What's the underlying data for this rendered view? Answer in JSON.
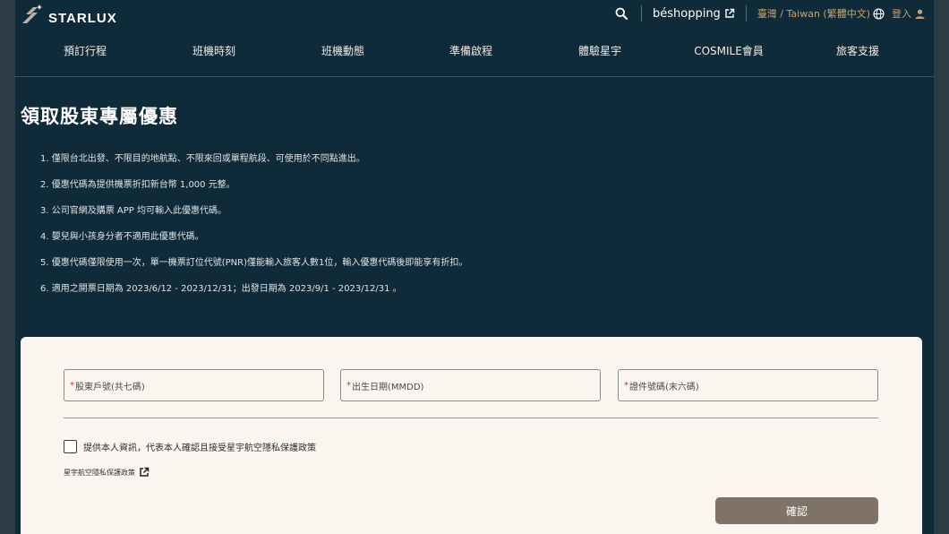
{
  "header": {
    "brand": "STARLUX",
    "beshopping": "béshopping",
    "region": "臺灣 / Taiwan (繁體中文)",
    "login": "登入"
  },
  "nav": {
    "items": [
      {
        "label": "預訂行程"
      },
      {
        "label": "班機時刻"
      },
      {
        "label": "班機動態"
      },
      {
        "label": "準備啟程"
      },
      {
        "label": "體驗星宇"
      },
      {
        "label": "COSMILE會員"
      },
      {
        "label": "旅客支援"
      }
    ]
  },
  "main": {
    "title": "領取股東專屬優惠",
    "terms": [
      "1. 僅限台北出發、不限目的地航點、不限來回或單程航段、可使用於不同點進出。",
      "2. 優惠代碼為提供機票折扣新台幣 1,000 元整。",
      "3. 公司官網及購票 APP 均可輸入此優惠代碼。",
      "4. 嬰兒與小孩身分者不適用此優惠代碼。",
      "5. 優惠代碼僅限使用一次，單一機票訂位代號(PNR)僅能輸入旅客人數1位，輸入優惠代碼後即能享有折扣。",
      "6. 適用之開票日期為 2023/6/12 - 2023/12/31；出發日期為 2023/9/1 - 2023/12/31 。"
    ]
  },
  "form": {
    "fields": [
      {
        "required_mark": "*",
        "placeholder": "股東戶號(共七碼)"
      },
      {
        "required_mark": "*",
        "placeholder": "出生日期(MMDD)"
      },
      {
        "required_mark": "*",
        "placeholder": "證件號碼(末六碼)"
      }
    ],
    "consent_label": "提供本人資訊，代表本人確認且接受星宇航空隱私保護政策",
    "privacy_link": "星宇航空隱私保護政策",
    "confirm_label": "確認"
  },
  "colors": {
    "page_bg": "#0f2b3a",
    "gold": "#c9a46a",
    "card_bg": "#fbf5ef",
    "button_bg": "#7f7266"
  }
}
